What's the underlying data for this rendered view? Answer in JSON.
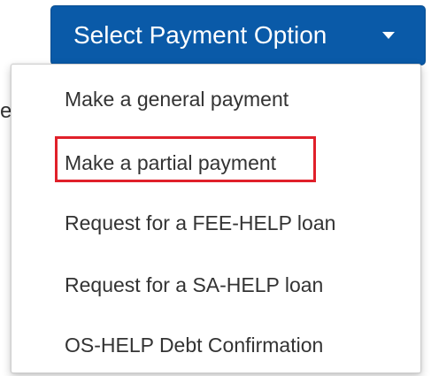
{
  "background": {
    "partial_text": "e"
  },
  "dropdown": {
    "button_label": "Select Payment Option",
    "caret_icon": "caret-down-icon",
    "button_color": "#0a5aa8",
    "items": [
      {
        "label": "Make a general payment"
      },
      {
        "label": "Make a partial payment",
        "highlighted": true
      },
      {
        "label": "Request for a FEE-HELP loan"
      },
      {
        "label": "Request for a SA-HELP loan"
      },
      {
        "label": "OS-HELP Debt Confirmation"
      }
    ],
    "highlight_color": "#e0202a"
  }
}
